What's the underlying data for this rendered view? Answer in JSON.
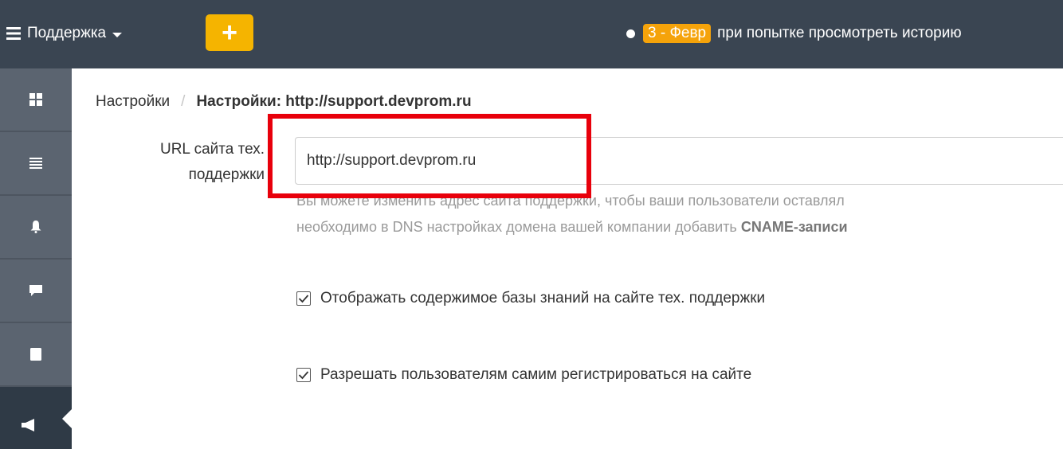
{
  "topbar": {
    "menu_label": "Поддержка",
    "menu_icon": "hamburger-icon",
    "add_label": "+",
    "notice_badge": "3 - Февр",
    "notice_text": "при попытке просмотреть историю"
  },
  "sidebar": {
    "items": [
      {
        "icon": "dashboard-icon"
      },
      {
        "icon": "list-icon"
      },
      {
        "icon": "bell-icon"
      },
      {
        "icon": "chat-icon"
      },
      {
        "icon": "document-icon"
      },
      {
        "icon": "megaphone-icon",
        "active": true
      }
    ]
  },
  "breadcrumb": {
    "parent": "Настройки",
    "separator": "/",
    "current": "Настройки: http://support.devprom.ru"
  },
  "form": {
    "url_label_line1": "URL сайта тех.",
    "url_label_line2": "поддержки",
    "url_value": "http://support.devprom.ru",
    "help_line1": "Вы можете изменить адрес сайта поддержки, чтобы ваши пользователи оставлял",
    "help_line2_prefix": "необходимо в DNS настройках домена вашей компании добавить ",
    "help_line2_bold": "CNAME-записи",
    "checkbox_kb_label": "Отображать содержимое базы знаний на сайте тех. поддержки",
    "checkbox_kb_checked": true,
    "checkbox_register_label": "Разрешать пользователям самим регистрироваться на сайте",
    "checkbox_register_checked": true
  },
  "colors": {
    "topbar_bg": "#3a4552",
    "sidebar_bg": "#5b6470",
    "accent_yellow": "#f5b400",
    "badge_orange": "#f5a30a",
    "highlight_red": "#e8000b"
  }
}
